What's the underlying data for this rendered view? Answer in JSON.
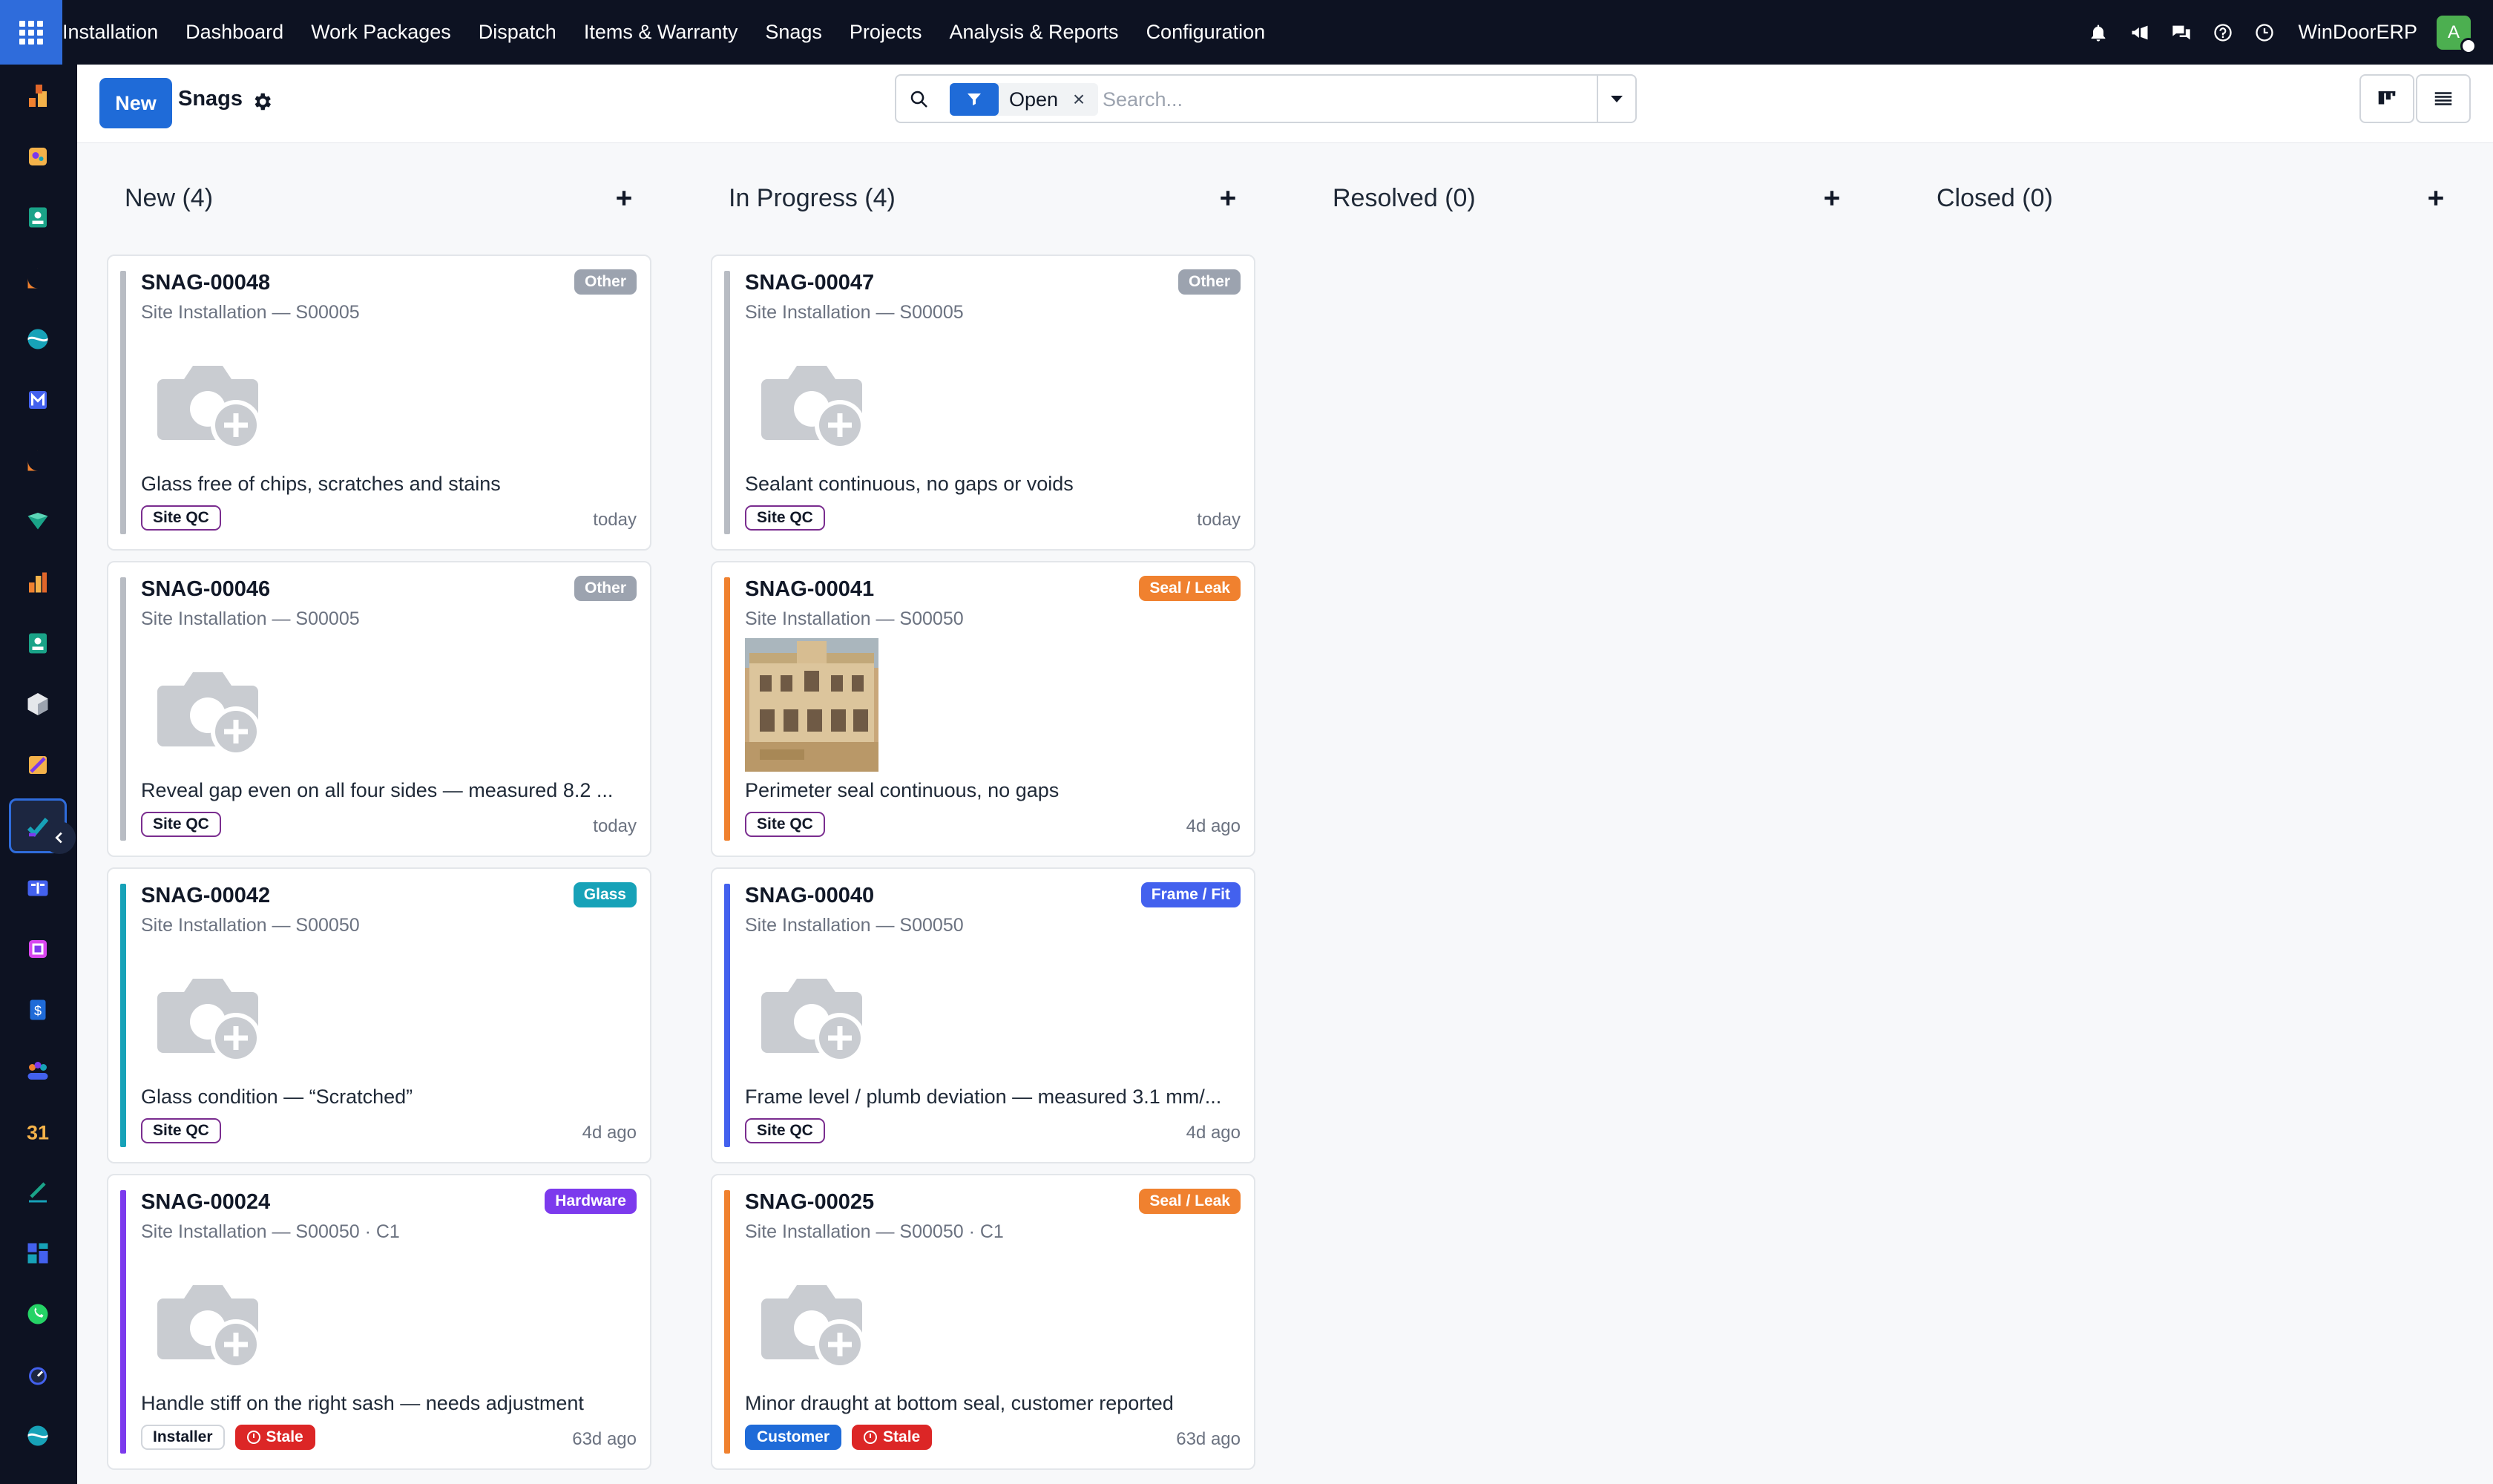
{
  "navbar": {
    "menu": [
      "Installation",
      "Dashboard",
      "Work Packages",
      "Dispatch",
      "Items & Warranty",
      "Snags",
      "Projects",
      "Analysis & Reports",
      "Configuration"
    ],
    "company": "WinDoorERP",
    "avatar_initial": "A",
    "icons": [
      "bell-icon",
      "megaphone-icon",
      "chat-icon",
      "help-icon",
      "clock-icon"
    ]
  },
  "sidebar": {
    "apps": [
      "stock-app",
      "plugins-app",
      "contacts-app",
      "discuss-app",
      "website-app",
      "mail-app",
      "helpdesk-app",
      "vault-app",
      "reporting-app",
      "employees-app",
      "inventory-app",
      "studio-app",
      "installation-app",
      "knowledge-app",
      "barcode-app",
      "invoicing-app",
      "community-app",
      "calendar-app",
      "sign-app",
      "dashboards-app",
      "whatsapp-app",
      "timer-app",
      "website-2-app"
    ],
    "active": "installation-app"
  },
  "control": {
    "new_label": "New",
    "title": "Snags",
    "filter_value": "Open",
    "search_placeholder": "Search..."
  },
  "columns": [
    {
      "title": "New (4)",
      "cards": [
        {
          "ref": "SNAG-00048",
          "sub": "Site Installation — S00005",
          "tag": "Other",
          "tag_color": "#9ca3af",
          "bar_color": "#b8bcc3",
          "desc": "Glass free of chips, scratches and stains",
          "chips": [
            "Site QC"
          ],
          "time": "today",
          "photo": false
        },
        {
          "ref": "SNAG-00046",
          "sub": "Site Installation — S00005",
          "tag": "Other",
          "tag_color": "#9ca3af",
          "bar_color": "#b8bcc3",
          "desc": "Reveal gap even on all four sides — measured 8.2 ...",
          "chips": [
            "Site QC"
          ],
          "time": "today",
          "photo": false
        },
        {
          "ref": "SNAG-00042",
          "sub": "Site Installation — S00050",
          "tag": "Glass",
          "tag_color": "#17a2b8",
          "bar_color": "#17a2b8",
          "desc": "Glass condition — “Scratched”",
          "chips": [
            "Site QC"
          ],
          "time": "4d ago",
          "photo": false
        },
        {
          "ref": "SNAG-00024",
          "sub": "Site Installation — S00050 · C1",
          "tag": "Hardware",
          "tag_color": "#7c3aed",
          "bar_color": "#7c3aed",
          "desc": "Handle stiff on the right sash — needs adjustment",
          "chips": [
            "Installer",
            "Stale"
          ],
          "time": "63d ago",
          "photo": false
        }
      ]
    },
    {
      "title": "In Progress (4)",
      "cards": [
        {
          "ref": "SNAG-00047",
          "sub": "Site Installation — S00005",
          "tag": "Other",
          "tag_color": "#9ca3af",
          "bar_color": "#b8bcc3",
          "desc": "Sealant continuous, no gaps or voids",
          "chips": [
            "Site QC"
          ],
          "time": "today",
          "photo": false
        },
        {
          "ref": "SNAG-00041",
          "sub": "Site Installation — S00050",
          "tag": "Seal / Leak",
          "tag_color": "#f0812f",
          "bar_color": "#f0812f",
          "desc": "Perimeter seal continuous, no gaps",
          "chips": [
            "Site QC"
          ],
          "time": "4d ago",
          "photo": true
        },
        {
          "ref": "SNAG-00040",
          "sub": "Site Installation — S00050",
          "tag": "Frame / Fit",
          "tag_color": "#4361ee",
          "bar_color": "#4361ee",
          "desc": "Frame level / plumb deviation — measured 3.1 mm/...",
          "chips": [
            "Site QC"
          ],
          "time": "4d ago",
          "photo": false
        },
        {
          "ref": "SNAG-00025",
          "sub": "Site Installation — S00050 · C1",
          "tag": "Seal / Leak",
          "tag_color": "#f0812f",
          "bar_color": "#f0812f",
          "desc": "Minor draught at bottom seal, customer reported",
          "chips": [
            "Customer",
            "Stale"
          ],
          "time": "63d ago",
          "photo": false
        }
      ]
    },
    {
      "title": "Resolved (0)",
      "cards": []
    },
    {
      "title": "Closed (0)",
      "cards": []
    }
  ]
}
